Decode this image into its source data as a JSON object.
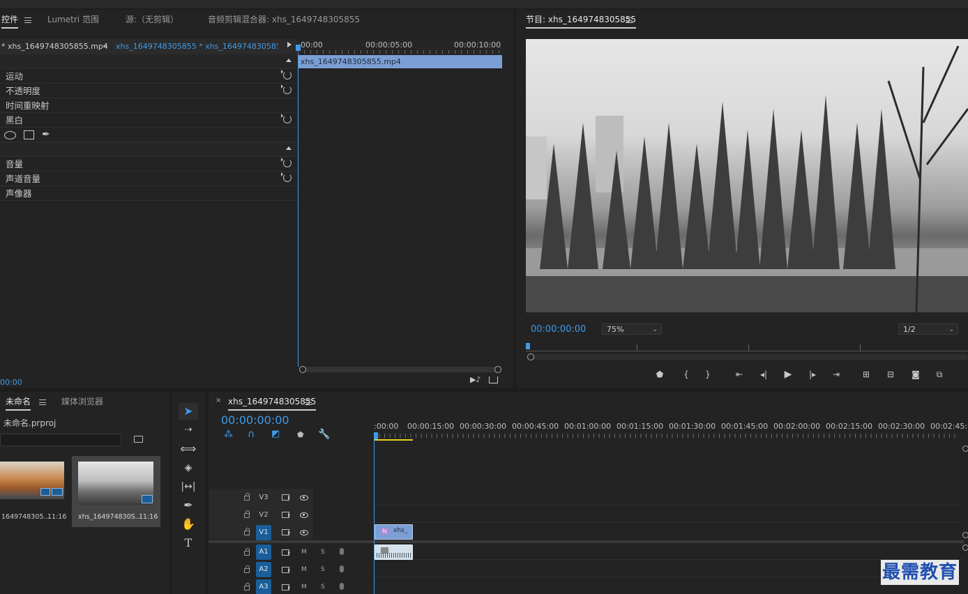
{
  "effect_controls": {
    "tabs": {
      "effect_controls": "控件",
      "lumetri_scopes": "Lumetri 范围",
      "source": "源:（无剪辑）",
      "audio_clip_mixer": "音频剪辑混合器: xhs_1649748305855"
    },
    "source_clip": "* xhs_1649748305855.mp4",
    "sequence_clip": "xhs_1649748305855 * xhs_1649748305855...",
    "mini_ruler": [
      "00:00",
      "00:00:05:00",
      "00:00:10:00"
    ],
    "mini_clip_name": "xhs_1649748305855.mp4",
    "video_effects": [
      "运动",
      "不透明度",
      "时间重映射",
      "黑白"
    ],
    "audio_effects": [
      "音量",
      "声道音量",
      "声像器"
    ],
    "timecode": "00:00"
  },
  "program_monitor": {
    "title": "节目: xhs_1649748305855",
    "timecode": "00:00:00:00",
    "zoom": "75%",
    "resolution": "1/2"
  },
  "project": {
    "tabs": {
      "project": "未命名",
      "media_browser": "媒体浏览器"
    },
    "file": "未命名.prproj",
    "items": [
      {
        "name": "1649748305...",
        "duration": "11:16"
      },
      {
        "name": "xhs_164974830S...",
        "duration": "11:16"
      }
    ]
  },
  "timeline": {
    "tab_title": "xhs_1649748305855",
    "timecode": "00:00:00:00",
    "ruler": [
      ":00:00",
      "00:00:15:00",
      "00:00:30:00",
      "00:00:45:00",
      "00:01:00:00",
      "00:01:15:00",
      "00:01:30:00",
      "00:01:45:00",
      "00:02:00:00",
      "00:02:15:00",
      "00:02:30:00",
      "00:02:45:"
    ],
    "video_tracks": [
      "V3",
      "V2",
      "V1"
    ],
    "audio_tracks": [
      "A1",
      "A2",
      "A3"
    ],
    "m_label": "M",
    "s_label": "S",
    "clip_label": "xhs_"
  },
  "watermark": "最需教育",
  "colors": {
    "accent_blue": "#3f9be8",
    "track_blue": "#1b5e99",
    "clip_blue": "#7b9fd4",
    "work_area_yellow": "#e8d21c"
  }
}
